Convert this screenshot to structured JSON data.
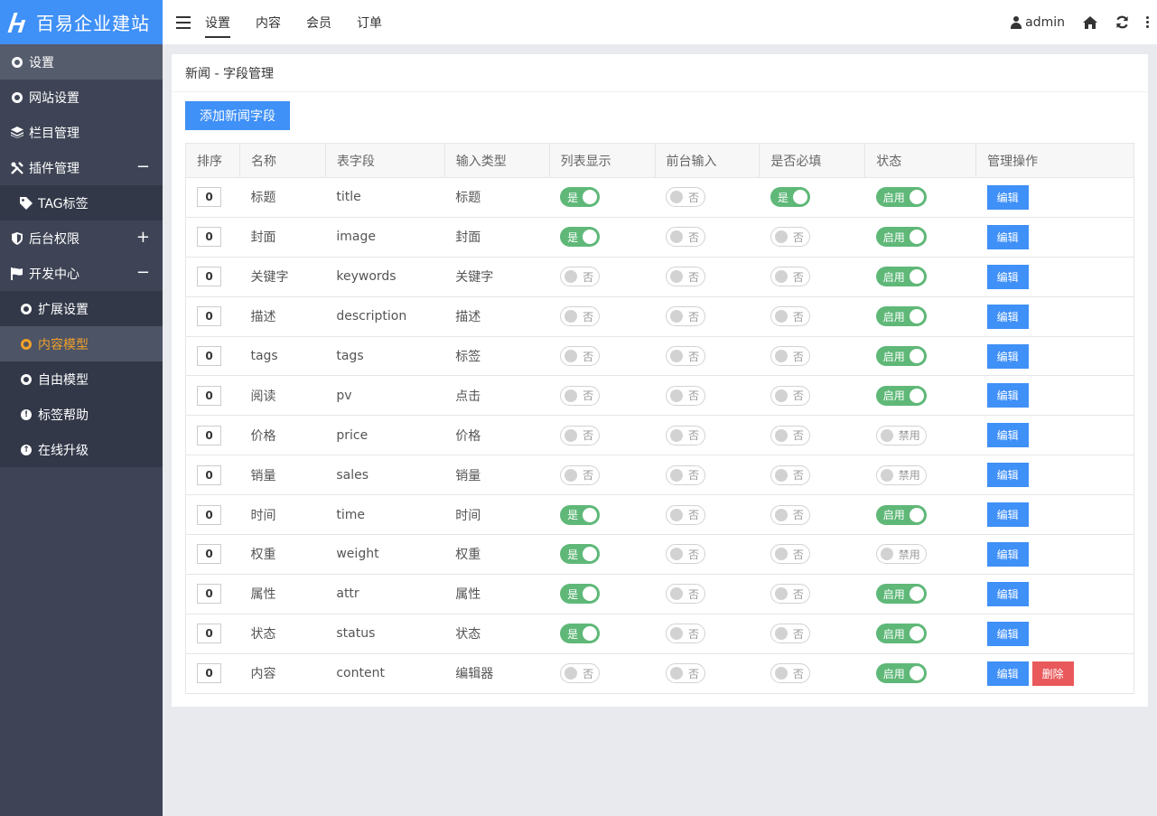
{
  "app": {
    "logo_text": "百易企业建站"
  },
  "sidebar": {
    "items": [
      {
        "label": "设置",
        "icon": "gear-icon",
        "type": "head"
      },
      {
        "label": "网站设置",
        "icon": "gear-icon",
        "type": "main"
      },
      {
        "label": "栏目管理",
        "icon": "layers-icon",
        "type": "main"
      },
      {
        "label": "插件管理",
        "icon": "tools-icon",
        "type": "main",
        "toggle": "−"
      },
      {
        "label": "TAG标签",
        "icon": "tag-icon",
        "type": "sub"
      },
      {
        "label": "后台权限",
        "icon": "shield-icon",
        "type": "main",
        "toggle": "+"
      },
      {
        "label": "开发中心",
        "icon": "flag-icon",
        "type": "main",
        "toggle": "−"
      },
      {
        "label": "扩展设置",
        "icon": "gear-icon",
        "type": "sub"
      },
      {
        "label": "内容模型",
        "icon": "gear-icon",
        "type": "sub",
        "active": true
      },
      {
        "label": "自由模型",
        "icon": "gear-icon",
        "type": "sub"
      },
      {
        "label": "标签帮助",
        "icon": "info-icon",
        "type": "sub"
      },
      {
        "label": "在线升级",
        "icon": "upgrade-icon",
        "type": "sub"
      }
    ]
  },
  "topbar": {
    "tabs": [
      "设置",
      "内容",
      "会员",
      "订单"
    ],
    "active_tab": 0,
    "user": "admin"
  },
  "panel": {
    "breadcrumb": "新闻 - 字段管理",
    "add_button": "添加新闻字段"
  },
  "table": {
    "headers": [
      "排序",
      "名称",
      "表字段",
      "输入类型",
      "列表显示",
      "前台输入",
      "是否必填",
      "状态",
      "管理操作"
    ],
    "edit_label": "编辑",
    "delete_label": "删除",
    "yes_label": "是",
    "no_label": "否",
    "enabled_label": "启用",
    "disabled_label": "禁用",
    "rows": [
      {
        "sort": "0",
        "name": "标题",
        "field": "title",
        "input_type": "标题",
        "list_show": true,
        "front_input": false,
        "required": true,
        "enabled": true,
        "deletable": false
      },
      {
        "sort": "0",
        "name": "封面",
        "field": "image",
        "input_type": "封面",
        "list_show": true,
        "front_input": false,
        "required": false,
        "enabled": true,
        "deletable": false
      },
      {
        "sort": "0",
        "name": "关键字",
        "field": "keywords",
        "input_type": "关键字",
        "list_show": false,
        "front_input": false,
        "required": false,
        "enabled": true,
        "deletable": false
      },
      {
        "sort": "0",
        "name": "描述",
        "field": "description",
        "input_type": "描述",
        "list_show": false,
        "front_input": false,
        "required": false,
        "enabled": true,
        "deletable": false
      },
      {
        "sort": "0",
        "name": "tags",
        "field": "tags",
        "input_type": "标签",
        "list_show": false,
        "front_input": false,
        "required": false,
        "enabled": true,
        "deletable": false
      },
      {
        "sort": "0",
        "name": "阅读",
        "field": "pv",
        "input_type": "点击",
        "list_show": false,
        "front_input": false,
        "required": false,
        "enabled": true,
        "deletable": false
      },
      {
        "sort": "0",
        "name": "价格",
        "field": "price",
        "input_type": "价格",
        "list_show": false,
        "front_input": false,
        "required": false,
        "enabled": false,
        "deletable": false
      },
      {
        "sort": "0",
        "name": "销量",
        "field": "sales",
        "input_type": "销量",
        "list_show": false,
        "front_input": false,
        "required": false,
        "enabled": false,
        "deletable": false
      },
      {
        "sort": "0",
        "name": "时间",
        "field": "time",
        "input_type": "时间",
        "list_show": true,
        "front_input": false,
        "required": false,
        "enabled": true,
        "deletable": false
      },
      {
        "sort": "0",
        "name": "权重",
        "field": "weight",
        "input_type": "权重",
        "list_show": true,
        "front_input": false,
        "required": false,
        "enabled": false,
        "deletable": false
      },
      {
        "sort": "0",
        "name": "属性",
        "field": "attr",
        "input_type": "属性",
        "list_show": true,
        "front_input": false,
        "required": false,
        "enabled": true,
        "deletable": false
      },
      {
        "sort": "0",
        "name": "状态",
        "field": "status",
        "input_type": "状态",
        "list_show": true,
        "front_input": false,
        "required": false,
        "enabled": true,
        "deletable": false
      },
      {
        "sort": "0",
        "name": "内容",
        "field": "content",
        "input_type": "编辑器",
        "list_show": false,
        "front_input": false,
        "required": false,
        "enabled": true,
        "deletable": true
      }
    ]
  },
  "colors": {
    "accent": "#3f90f7",
    "switch_on": "#5fb878",
    "delete": "#e9595b",
    "sidebar": "#3e4455",
    "active_menu_text": "#f0a02a"
  }
}
